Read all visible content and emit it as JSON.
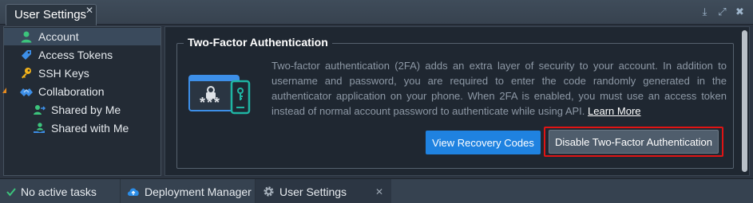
{
  "window": {
    "tab_title": "User Settings",
    "tab_close": "✕",
    "controls": [
      {
        "name": "download-icon",
        "glyph": "⤓"
      },
      {
        "name": "maximize-icon",
        "glyph": "⤢"
      },
      {
        "name": "close-icon",
        "glyph": "✖"
      }
    ]
  },
  "sidebar": {
    "items": [
      {
        "label": "Account",
        "icon": "user-icon",
        "active": true
      },
      {
        "label": "Access Tokens",
        "icon": "tag-icon"
      },
      {
        "label": "SSH Keys",
        "icon": "key-icon"
      },
      {
        "label": "Collaboration",
        "icon": "handshake-icon",
        "expanded": true
      },
      {
        "label": "Shared by Me",
        "icon": "users-share-icon"
      },
      {
        "label": "Shared with Me",
        "icon": "hand-share-icon"
      }
    ]
  },
  "main": {
    "section_title": "Two-Factor Authentication",
    "description": "Two-factor authentication (2FA) adds an extra layer of security to your account. In addition to username and password, you are required to enter the code randomly generated in the authenticator application on your phone. When 2FA is enabled, you must use an access token instead of normal account password to authenticate while using API.",
    "learn_more": "Learn More",
    "view_codes_button": "View Recovery Codes",
    "disable_button": "Disable Two-Factor Authentication",
    "password_mask": "***"
  },
  "taskbar": {
    "items": [
      {
        "label": "No active tasks",
        "icon": "check-icon"
      },
      {
        "label": "Deployment Manager",
        "icon": "cloud-icon"
      },
      {
        "label": "User Settings",
        "icon": "gear-icon"
      }
    ],
    "close": "✕"
  },
  "colors": {
    "accent": "#1f82e0",
    "highlight_border": "#e01414",
    "teal": "#1fb5a3",
    "orange": "#e58a1f"
  }
}
